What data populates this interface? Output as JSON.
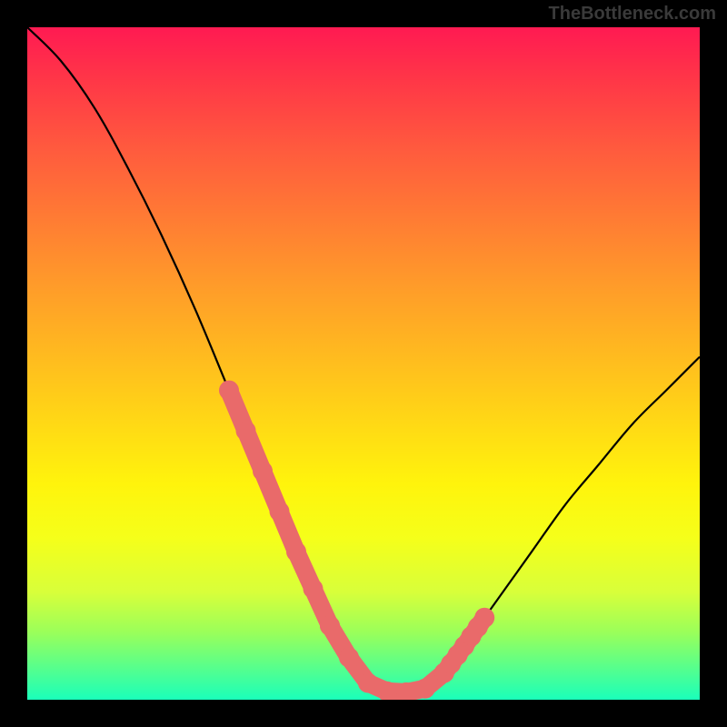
{
  "watermark": "TheBottleneck.com",
  "chart_data": {
    "type": "line",
    "title": "",
    "xlabel": "",
    "ylabel": "",
    "xlim": [
      0,
      100
    ],
    "ylim": [
      0,
      100
    ],
    "grid": false,
    "legend": false,
    "background_gradient": {
      "top": "#ff1a52",
      "mid": "#fff40c",
      "bottom": "#1affba"
    },
    "series": [
      {
        "name": "curve",
        "x": [
          0,
          5,
          10,
          15,
          20,
          25,
          30,
          35,
          40,
          45,
          48,
          50,
          52,
          55,
          58,
          60,
          62,
          65,
          70,
          75,
          80,
          85,
          90,
          95,
          100
        ],
        "y": [
          100,
          95,
          88,
          79,
          69,
          58,
          46,
          34,
          22,
          11,
          6,
          3,
          1.5,
          1,
          1.2,
          2,
          4,
          8,
          15,
          22,
          29,
          35,
          41,
          46,
          51
        ]
      }
    ],
    "highlighted_segments": [
      {
        "x_range": [
          30,
          45
        ],
        "side": "left"
      },
      {
        "x_range": [
          45,
          62
        ],
        "side": "bottom"
      },
      {
        "x_range": [
          62,
          68
        ],
        "side": "right"
      }
    ]
  }
}
